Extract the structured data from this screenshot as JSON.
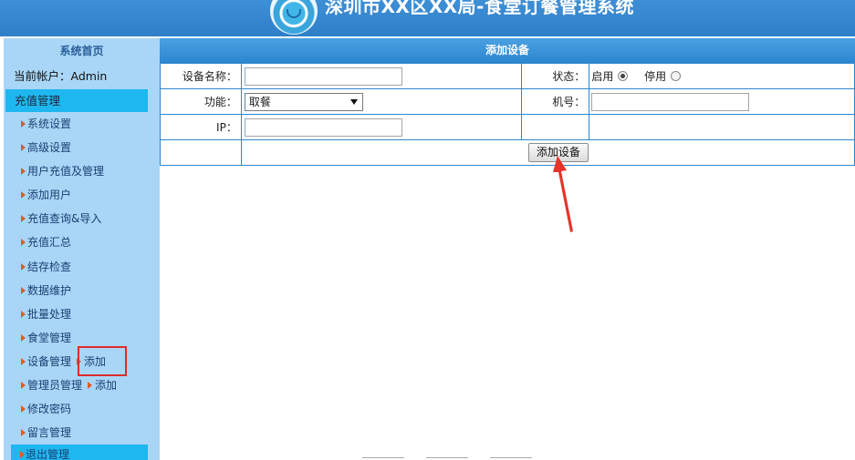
{
  "header": {
    "title": "深圳市XX区XX局-食堂订餐管理系统"
  },
  "sidebar": {
    "home": "系统首页",
    "account": "当前帐户：Admin",
    "section": "充值管理",
    "items": [
      {
        "label": "系统设置"
      },
      {
        "label": "高级设置"
      },
      {
        "label": "用户充值及管理"
      },
      {
        "label": "添加用户"
      },
      {
        "label": "充值查询&导入"
      },
      {
        "label": "充值汇总"
      },
      {
        "label": "结存检查"
      },
      {
        "label": "数据维护"
      },
      {
        "label": "批量处理"
      },
      {
        "label": "食堂管理"
      },
      {
        "label": "设备管理",
        "sub": "添加"
      },
      {
        "label": "管理员管理",
        "sub": "添加"
      },
      {
        "label": "修改密码"
      },
      {
        "label": "留言管理"
      }
    ],
    "exit": "退出管理"
  },
  "form": {
    "title": "添加设备",
    "name_label": "设备名称：",
    "name_value": "",
    "status_label": "状态：",
    "status_enabled": "启用",
    "status_disabled": "停用",
    "status_selected": "启用",
    "function_label": "功能：",
    "function_value": "取餐",
    "number_label": "机号：",
    "number_value": "",
    "ip_label": "IP：",
    "ip_value": "",
    "submit_label": "添加设备"
  },
  "colors": {
    "accent": "#2d86cf",
    "sidebar": "#a9d6f7",
    "highlight": "#1fb7f0",
    "annotation": "#e02a2a"
  }
}
